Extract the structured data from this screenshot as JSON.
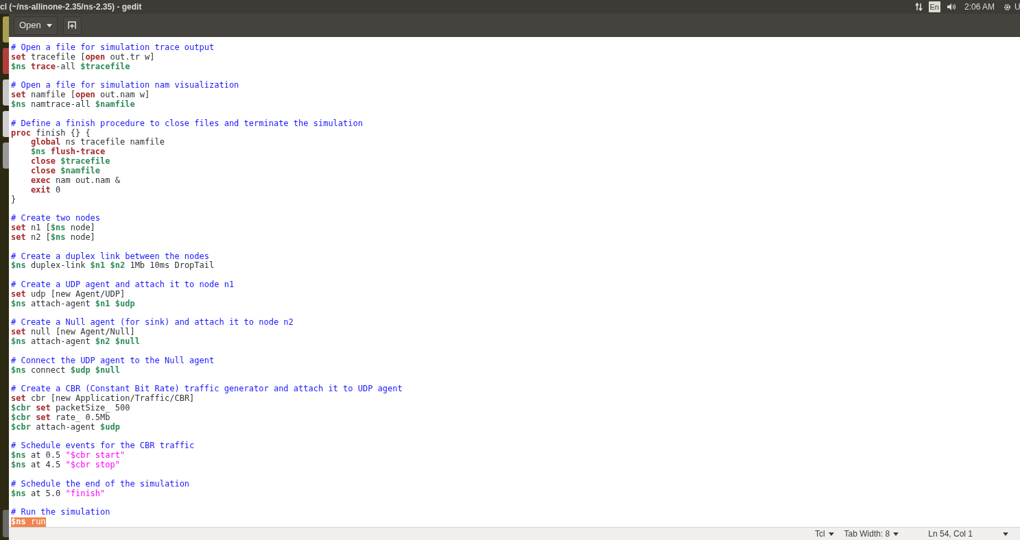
{
  "top_panel": {
    "title": "cl (~/ns-allinone-2.35/ns-2.35) - gedit",
    "keyboard_layout": "En",
    "clock": "2:06 AM",
    "user_menu": "U"
  },
  "toolbar": {
    "open_button": "Open"
  },
  "editor": {
    "blocks": [
      [
        {
          "selected": false,
          "tokens": [
            {
              "text": "# Open a file for simulation trace output",
              "kind": "comment"
            }
          ]
        },
        {
          "selected": false,
          "tokens": [
            {
              "text": "set",
              "kind": "keyword"
            },
            {
              "text": " tracefile [",
              "kind": "plain"
            },
            {
              "text": "open",
              "kind": "keyword"
            },
            {
              "text": " out.tr w]",
              "kind": "plain"
            }
          ]
        },
        {
          "selected": false,
          "tokens": [
            {
              "text": "$ns ",
              "kind": "variable"
            },
            {
              "text": "trace",
              "kind": "keyword"
            },
            {
              "text": "-all ",
              "kind": "plain"
            },
            {
              "text": "$tracefile",
              "kind": "variable"
            }
          ]
        }
      ],
      [
        {
          "selected": false,
          "tokens": [
            {
              "text": "# Open a file for simulation nam visualization",
              "kind": "comment"
            }
          ]
        },
        {
          "selected": false,
          "tokens": [
            {
              "text": "set",
              "kind": "keyword"
            },
            {
              "text": " namfile [",
              "kind": "plain"
            },
            {
              "text": "open",
              "kind": "keyword"
            },
            {
              "text": " out.nam w]",
              "kind": "plain"
            }
          ]
        },
        {
          "selected": false,
          "tokens": [
            {
              "text": "$ns",
              "kind": "variable"
            },
            {
              "text": " namtrace-all ",
              "kind": "plain"
            },
            {
              "text": "$namfile",
              "kind": "variable"
            }
          ]
        }
      ],
      [
        {
          "selected": false,
          "tokens": [
            {
              "text": "# Define a finish procedure to close files and terminate the simulation",
              "kind": "comment"
            }
          ]
        },
        {
          "selected": false,
          "tokens": [
            {
              "text": "proc",
              "kind": "keyword"
            },
            {
              "text": " finish {} {",
              "kind": "plain"
            }
          ]
        },
        {
          "selected": false,
          "tokens": [
            {
              "text": "    global",
              "kind": "keyword"
            },
            {
              "text": " ns tracefile namfile",
              "kind": "plain"
            }
          ]
        },
        {
          "selected": false,
          "tokens": [
            {
              "text": "    $ns ",
              "kind": "variable"
            },
            {
              "text": "flush-trace",
              "kind": "keyword"
            }
          ]
        },
        {
          "selected": false,
          "tokens": [
            {
              "text": "    close ",
              "kind": "keyword"
            },
            {
              "text": "$tracefile",
              "kind": "variable"
            }
          ]
        },
        {
          "selected": false,
          "tokens": [
            {
              "text": "    close ",
              "kind": "keyword"
            },
            {
              "text": "$namfile",
              "kind": "variable"
            }
          ]
        },
        {
          "selected": false,
          "tokens": [
            {
              "text": "    exec",
              "kind": "keyword"
            },
            {
              "text": " nam out.nam &",
              "kind": "plain"
            }
          ]
        },
        {
          "selected": false,
          "tokens": [
            {
              "text": "    exit",
              "kind": "keyword"
            },
            {
              "text": " 0",
              "kind": "plain"
            }
          ]
        },
        {
          "selected": false,
          "tokens": [
            {
              "text": "}",
              "kind": "plain"
            }
          ]
        }
      ],
      [
        {
          "selected": false,
          "tokens": [
            {
              "text": "# Create two nodes",
              "kind": "comment"
            }
          ]
        },
        {
          "selected": false,
          "tokens": [
            {
              "text": "set",
              "kind": "keyword"
            },
            {
              "text": " n1 [",
              "kind": "plain"
            },
            {
              "text": "$ns",
              "kind": "variable"
            },
            {
              "text": " node]",
              "kind": "plain"
            }
          ]
        },
        {
          "selected": false,
          "tokens": [
            {
              "text": "set",
              "kind": "keyword"
            },
            {
              "text": " n2 [",
              "kind": "plain"
            },
            {
              "text": "$ns",
              "kind": "variable"
            },
            {
              "text": " node]",
              "kind": "plain"
            }
          ]
        }
      ],
      [
        {
          "selected": false,
          "tokens": [
            {
              "text": "# Create a duplex link between the nodes",
              "kind": "comment"
            }
          ]
        },
        {
          "selected": false,
          "tokens": [
            {
              "text": "$ns",
              "kind": "variable"
            },
            {
              "text": " duplex-link ",
              "kind": "plain"
            },
            {
              "text": "$n1 $n2",
              "kind": "variable"
            },
            {
              "text": " 1Mb 10ms DropTail",
              "kind": "plain"
            }
          ]
        }
      ],
      [
        {
          "selected": false,
          "tokens": [
            {
              "text": "# Create a UDP agent and attach it to node n1",
              "kind": "comment"
            }
          ]
        },
        {
          "selected": false,
          "tokens": [
            {
              "text": "set",
              "kind": "keyword"
            },
            {
              "text": " udp [new Agent/UDP]",
              "kind": "plain"
            }
          ]
        },
        {
          "selected": false,
          "tokens": [
            {
              "text": "$ns",
              "kind": "variable"
            },
            {
              "text": " attach-agent ",
              "kind": "plain"
            },
            {
              "text": "$n1 $udp",
              "kind": "variable"
            }
          ]
        }
      ],
      [
        {
          "selected": false,
          "tokens": [
            {
              "text": "# Create a Null agent (for sink) and attach it to node n2",
              "kind": "comment"
            }
          ]
        },
        {
          "selected": false,
          "tokens": [
            {
              "text": "set",
              "kind": "keyword"
            },
            {
              "text": " null [new Agent/Null]",
              "kind": "plain"
            }
          ]
        },
        {
          "selected": false,
          "tokens": [
            {
              "text": "$ns",
              "kind": "variable"
            },
            {
              "text": " attach-agent ",
              "kind": "plain"
            },
            {
              "text": "$n2 $null",
              "kind": "variable"
            }
          ]
        }
      ],
      [
        {
          "selected": false,
          "tokens": [
            {
              "text": "# Connect the UDP agent to the Null agent",
              "kind": "comment"
            }
          ]
        },
        {
          "selected": false,
          "tokens": [
            {
              "text": "$ns",
              "kind": "variable"
            },
            {
              "text": " connect ",
              "kind": "plain"
            },
            {
              "text": "$udp $null",
              "kind": "variable"
            }
          ]
        }
      ],
      [
        {
          "selected": false,
          "tokens": [
            {
              "text": "# Create a CBR (Constant Bit Rate) traffic generator and attach it to UDP agent",
              "kind": "comment"
            }
          ]
        },
        {
          "selected": false,
          "tokens": [
            {
              "text": "set",
              "kind": "keyword"
            },
            {
              "text": " cbr [new Application/Traffic/CBR]",
              "kind": "plain"
            }
          ]
        },
        {
          "selected": false,
          "tokens": [
            {
              "text": "$cbr ",
              "kind": "variable"
            },
            {
              "text": "set",
              "kind": "keyword"
            },
            {
              "text": " packetSize_ 500",
              "kind": "plain"
            }
          ]
        },
        {
          "selected": false,
          "tokens": [
            {
              "text": "$cbr ",
              "kind": "variable"
            },
            {
              "text": "set",
              "kind": "keyword"
            },
            {
              "text": " rate_ 0.5Mb",
              "kind": "plain"
            }
          ]
        },
        {
          "selected": false,
          "tokens": [
            {
              "text": "$cbr",
              "kind": "variable"
            },
            {
              "text": " attach-agent ",
              "kind": "plain"
            },
            {
              "text": "$udp",
              "kind": "variable"
            }
          ]
        }
      ],
      [
        {
          "selected": false,
          "tokens": [
            {
              "text": "# Schedule events for the CBR traffic",
              "kind": "comment"
            }
          ]
        },
        {
          "selected": false,
          "tokens": [
            {
              "text": "$ns",
              "kind": "variable"
            },
            {
              "text": " at 0.5 ",
              "kind": "plain"
            },
            {
              "text": "\"$cbr start\"",
              "kind": "string"
            }
          ]
        },
        {
          "selected": false,
          "tokens": [
            {
              "text": "$ns",
              "kind": "variable"
            },
            {
              "text": " at 4.5 ",
              "kind": "plain"
            },
            {
              "text": "\"$cbr stop\"",
              "kind": "string"
            }
          ]
        }
      ],
      [
        {
          "selected": false,
          "tokens": [
            {
              "text": "# Schedule the end of the simulation",
              "kind": "comment"
            }
          ]
        },
        {
          "selected": false,
          "tokens": [
            {
              "text": "$ns",
              "kind": "variable"
            },
            {
              "text": " at 5.0 ",
              "kind": "plain"
            },
            {
              "text": "\"finish\"",
              "kind": "string"
            }
          ]
        }
      ],
      [
        {
          "selected": false,
          "tokens": [
            {
              "text": "# Run the simulation",
              "kind": "comment"
            }
          ]
        },
        {
          "selected": true,
          "tokens": [
            {
              "text": "$ns",
              "kind": "variable"
            },
            {
              "text": " run",
              "kind": "plain"
            }
          ]
        }
      ]
    ]
  },
  "status_bar": {
    "language": "Tcl",
    "tab_width": "Tab Width: 8",
    "position": "Ln 54, Col 1"
  }
}
